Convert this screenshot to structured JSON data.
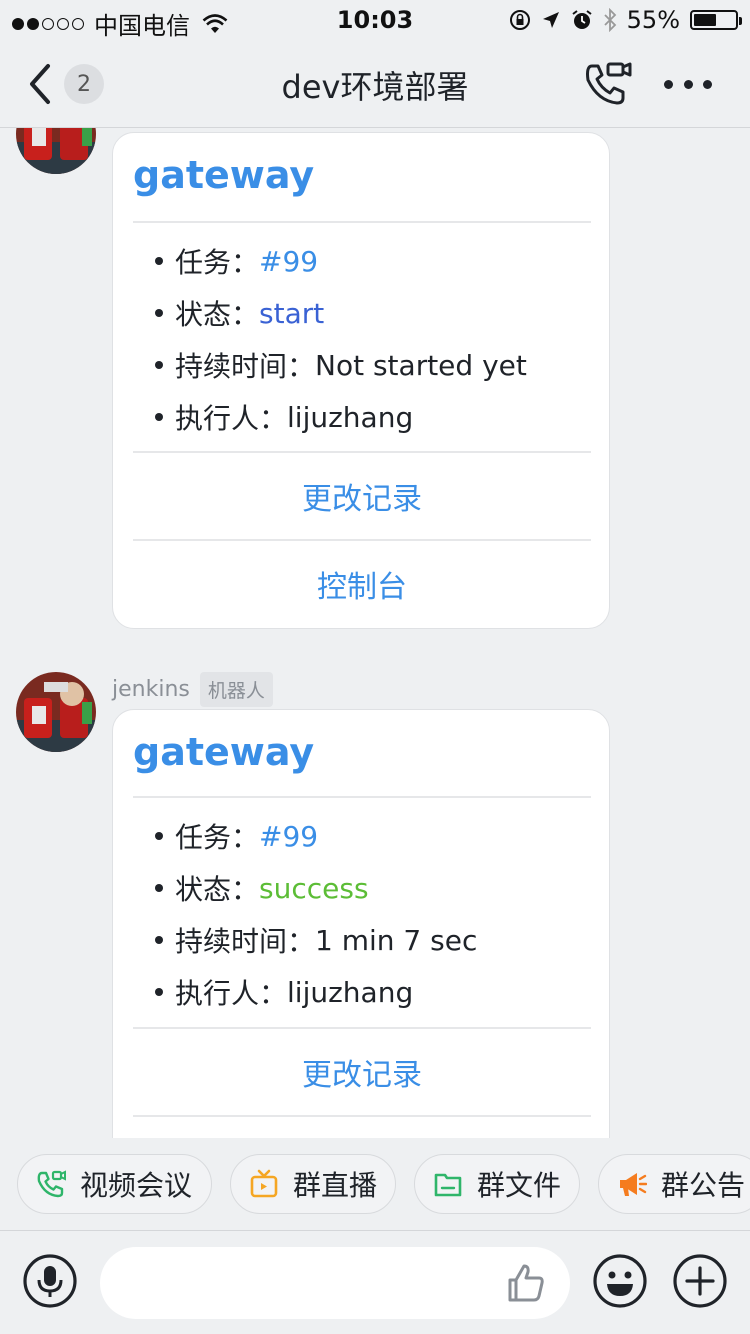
{
  "status_bar": {
    "carrier": "中国电信",
    "time": "10:03",
    "battery": "55%",
    "battery_level": 0.55
  },
  "nav": {
    "back_badge": "2",
    "title": "dev环境部署"
  },
  "messages": [
    {
      "sender": "",
      "card": {
        "title": "gateway",
        "fields": [
          {
            "label": "任务：",
            "value": "#99",
            "value_style": "link"
          },
          {
            "label": "状态：",
            "value": "start",
            "value_style": "start"
          },
          {
            "label": "持续时间：",
            "value": "Not started yet",
            "value_style": "plain"
          },
          {
            "label": "执行人：",
            "value": "lijuzhang",
            "value_style": "plain"
          }
        ],
        "actions": [
          "更改记录",
          "控制台"
        ]
      }
    },
    {
      "sender": "jenkins",
      "sender_tag": "机器人",
      "card": {
        "title": "gateway",
        "fields": [
          {
            "label": "任务：",
            "value": "#99",
            "value_style": "link"
          },
          {
            "label": "状态：",
            "value": "success",
            "value_style": "success"
          },
          {
            "label": "持续时间：",
            "value": "1 min 7 sec",
            "value_style": "plain"
          },
          {
            "label": "执行人：",
            "value": "lijuzhang",
            "value_style": "plain"
          }
        ],
        "actions": [
          "更改记录"
        ]
      }
    }
  ],
  "quick_actions": [
    {
      "label": "视频会议",
      "icon": "video-call-icon",
      "color": "#2fb56a"
    },
    {
      "label": "群直播",
      "icon": "live-tv-icon",
      "color": "#f5a623"
    },
    {
      "label": "群文件",
      "icon": "folder-icon",
      "color": "#2fb56a"
    },
    {
      "label": "群公告",
      "icon": "megaphone-icon",
      "color": "#f57c1f"
    }
  ],
  "input": {
    "placeholder": ""
  },
  "colors": {
    "link": "#3a8ee6",
    "status_start": "#3a62d4",
    "status_success": "#5cbd36",
    "background": "#eef0f2"
  }
}
